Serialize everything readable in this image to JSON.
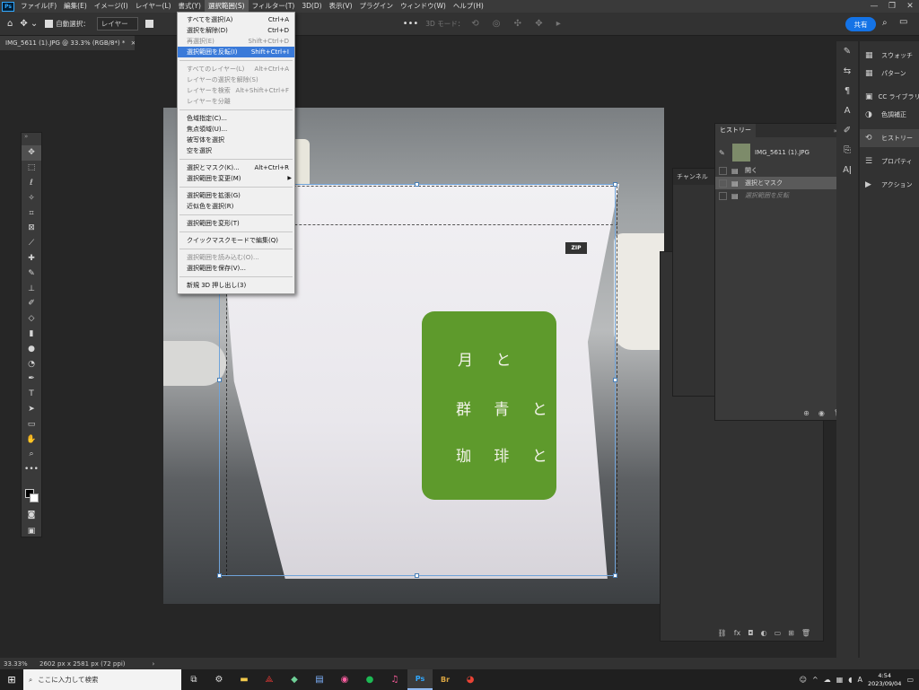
{
  "app": {
    "logo": "Ps"
  },
  "menubar": {
    "items": [
      "ファイル(F)",
      "編集(E)",
      "イメージ(I)",
      "レイヤー(L)",
      "書式(Y)",
      "選択範囲(S)",
      "フィルター(T)",
      "3D(D)",
      "表示(V)",
      "プラグイン",
      "ウィンドウ(W)",
      "ヘルプ(H)"
    ],
    "active_index": 5
  },
  "options": {
    "auto_select_label": "自動選択：",
    "auto_select_target": "レイヤー",
    "mode_3d": "3D モード：",
    "share_label": "共有"
  },
  "document": {
    "tab_title": "IMG_5611 (1).JPG @ 33.3% (RGB/8*) *",
    "zip_text": "ZIP",
    "label_lines": [
      "月 と",
      "群 青 と",
      "珈 琲 と"
    ]
  },
  "select_menu": {
    "groups": [
      [
        {
          "label": "すべてを選択(A)",
          "shortcut": "Ctrl+A",
          "disabled": false,
          "highlight": false
        },
        {
          "label": "選択を解除(D)",
          "shortcut": "Ctrl+D",
          "disabled": false,
          "highlight": false
        },
        {
          "label": "再選択(E)",
          "shortcut": "Shift+Ctrl+D",
          "disabled": true,
          "highlight": false
        },
        {
          "label": "選択範囲を反転(I)",
          "shortcut": "Shift+Ctrl+I",
          "disabled": false,
          "highlight": true
        }
      ],
      [
        {
          "label": "すべてのレイヤー(L)",
          "shortcut": "Alt+Ctrl+A",
          "disabled": true,
          "highlight": false
        },
        {
          "label": "レイヤーの選択を解除(S)",
          "shortcut": "",
          "disabled": true,
          "highlight": false
        },
        {
          "label": "レイヤーを検索",
          "shortcut": "Alt+Shift+Ctrl+F",
          "disabled": true,
          "highlight": false
        },
        {
          "label": "レイヤーを分離",
          "shortcut": "",
          "disabled": true,
          "highlight": false
        }
      ],
      [
        {
          "label": "色域指定(C)...",
          "shortcut": "",
          "disabled": false,
          "highlight": false
        },
        {
          "label": "焦点領域(U)...",
          "shortcut": "",
          "disabled": false,
          "highlight": false
        },
        {
          "label": "被写体を選択",
          "shortcut": "",
          "disabled": false,
          "highlight": false
        },
        {
          "label": "空を選択",
          "shortcut": "",
          "disabled": false,
          "highlight": false
        }
      ],
      [
        {
          "label": "選択とマスク(K)...",
          "shortcut": "Alt+Ctrl+R",
          "disabled": false,
          "highlight": false
        },
        {
          "label": "選択範囲を変更(M)",
          "shortcut": "",
          "disabled": false,
          "highlight": false,
          "submenu": true
        }
      ],
      [
        {
          "label": "選択範囲を拡張(G)",
          "shortcut": "",
          "disabled": false,
          "highlight": false
        },
        {
          "label": "近似色を選択(R)",
          "shortcut": "",
          "disabled": false,
          "highlight": false
        }
      ],
      [
        {
          "label": "選択範囲を変形(T)",
          "shortcut": "",
          "disabled": false,
          "highlight": false
        }
      ],
      [
        {
          "label": "クイックマスクモードで編集(Q)",
          "shortcut": "",
          "disabled": false,
          "highlight": false
        }
      ],
      [
        {
          "label": "選択範囲を読み込む(O)...",
          "shortcut": "",
          "disabled": true,
          "highlight": false
        },
        {
          "label": "選択範囲を保存(V)...",
          "shortcut": "",
          "disabled": false,
          "highlight": false
        }
      ],
      [
        {
          "label": "新規 3D 押し出し(3)",
          "shortcut": "",
          "disabled": false,
          "highlight": false
        }
      ]
    ]
  },
  "tools": [
    "move-icon",
    "marquee-icon",
    "lasso-icon",
    "magic-wand-icon",
    "crop-icon",
    "frame-icon",
    "eyedropper-icon",
    "healing-brush-icon",
    "brush-icon",
    "stamp-icon",
    "history-brush-icon",
    "eraser-icon",
    "gradient-icon",
    "blur-icon",
    "dodge-icon",
    "pen-icon",
    "type-icon",
    "path-select-icon",
    "rectangle-icon",
    "hand-icon",
    "zoom-icon",
    "more-icon"
  ],
  "dock": {
    "items": [
      {
        "label": "スウォッチ",
        "icon": "swatches-icon"
      },
      {
        "label": "パターン",
        "icon": "patterns-icon"
      },
      {
        "label": "CC ライブラリ",
        "icon": "libraries-icon"
      },
      {
        "label": "色調補正",
        "icon": "adjustments-icon"
      },
      {
        "label": "ヒストリー",
        "icon": "history-icon",
        "active": true
      },
      {
        "label": "プロパティ",
        "icon": "properties-icon"
      },
      {
        "label": "アクション",
        "icon": "actions-icon"
      }
    ]
  },
  "history": {
    "tab": "ヒストリー",
    "snapshot": "IMG_5611 (1).JPG",
    "states": [
      {
        "label": "開く",
        "selected": false,
        "dim": false
      },
      {
        "label": "選択とマスク",
        "selected": true,
        "dim": false
      },
      {
        "label": "選択範囲を反転",
        "selected": false,
        "dim": true
      }
    ]
  },
  "channels": {
    "tab": "チャンネル"
  },
  "status": {
    "zoom": "33.33%",
    "doc_size": "2602 px x 2581 px (72 ppi)"
  },
  "taskbar": {
    "search_placeholder": "ここに入力して検索",
    "time": "4:54",
    "date": "2023/09/04",
    "ime": "A"
  }
}
